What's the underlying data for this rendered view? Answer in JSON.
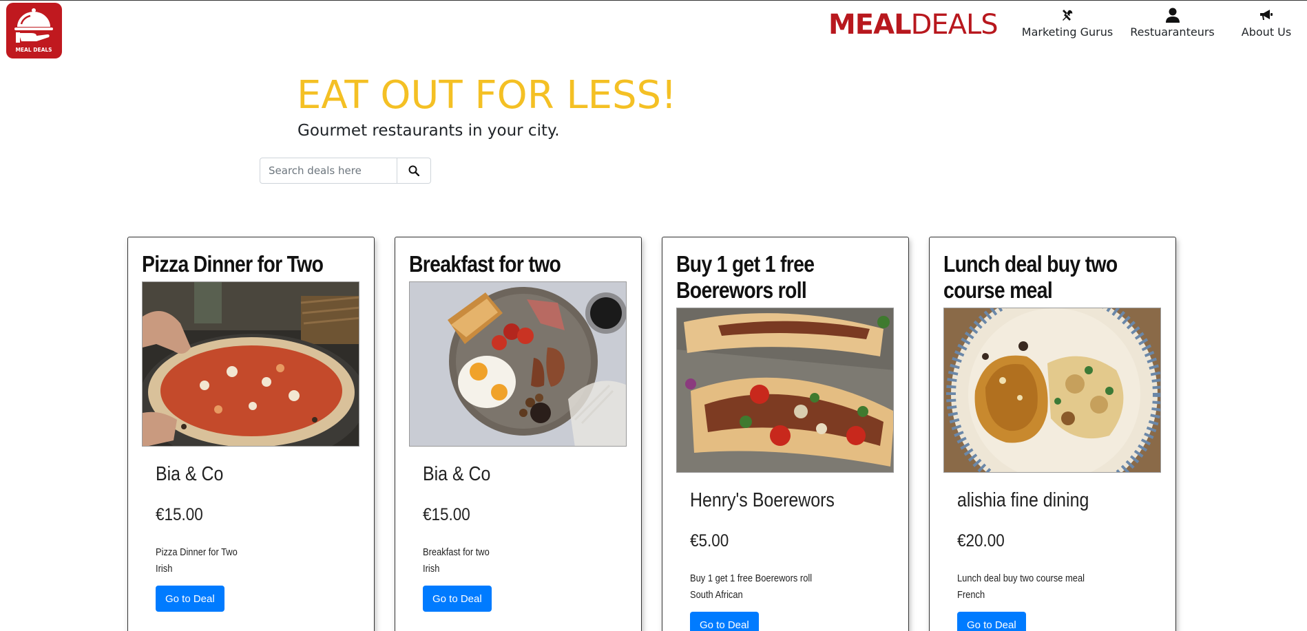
{
  "app": {
    "logo_text": "MEAL DEALS",
    "brand_part1": "MEAL",
    "brand_part2": "DEALS",
    "brand_color": "#b8181e"
  },
  "nav": {
    "items": [
      {
        "label": "Marketing Gurus",
        "icon": "tools-icon"
      },
      {
        "label": "Restuaranteurs",
        "icon": "user-icon"
      },
      {
        "label": "About Us",
        "icon": "megaphone-icon"
      }
    ]
  },
  "hero": {
    "title": "EAT OUT FOR LESS!",
    "subtitle": "Gourmet restaurants in your city.",
    "title_color": "#f4c024"
  },
  "search": {
    "placeholder": "Search deals here",
    "value": "",
    "icon": "search-icon"
  },
  "deals": [
    {
      "title": "Pizza Dinner for Two",
      "restaurant": "Bia & Co",
      "price": "€15.00",
      "description": "Pizza Dinner for Two",
      "cuisine": "Irish",
      "button": "Go to Deal"
    },
    {
      "title": "Breakfast for two",
      "restaurant": "Bia & Co",
      "price": "€15.00",
      "description": "Breakfast for two",
      "cuisine": "Irish",
      "button": "Go to Deal"
    },
    {
      "title": "Buy 1 get 1 free Boerewors roll",
      "restaurant": "Henry's Boerewors",
      "price": "€5.00",
      "description": "Buy 1 get 1 free Boerewors roll",
      "cuisine": "South African",
      "button": "Go to Deal"
    },
    {
      "title": "Lunch deal buy two course meal",
      "restaurant": "alishia fine dining",
      "price": "€20.00",
      "description": "Lunch deal buy two course meal",
      "cuisine": "French",
      "button": "Go to Deal"
    }
  ],
  "colors": {
    "button": "#007bff",
    "accent_red": "#c0191f"
  }
}
